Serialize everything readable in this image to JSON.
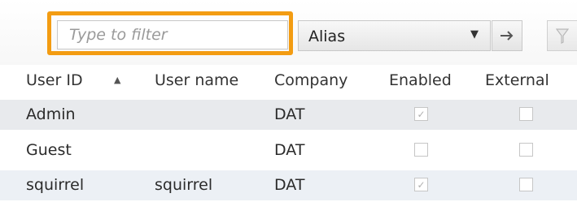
{
  "filter": {
    "placeholder": "Type to filter",
    "value": ""
  },
  "alias_select": {
    "selected": "Alias"
  },
  "icons": {
    "go": "arrow-right-icon",
    "dropdown": "chevron-down-icon",
    "filter_tool": "filter-funnel-icon",
    "sort": "sort-ascending-icon"
  },
  "colors": {
    "highlight": "#f39c12",
    "row_selected": "#e8eaed",
    "row_alt": "#ecf0f5"
  },
  "columns": [
    "User ID",
    "User name",
    "Company",
    "Enabled",
    "External"
  ],
  "rows": [
    {
      "user_id": "Admin",
      "user_name": "",
      "company": "DAT",
      "enabled": true,
      "external": false
    },
    {
      "user_id": "Guest",
      "user_name": "",
      "company": "DAT",
      "enabled": false,
      "external": false
    },
    {
      "user_id": "squirrel",
      "user_name": "squirrel",
      "company": "DAT",
      "enabled": true,
      "external": false
    }
  ]
}
